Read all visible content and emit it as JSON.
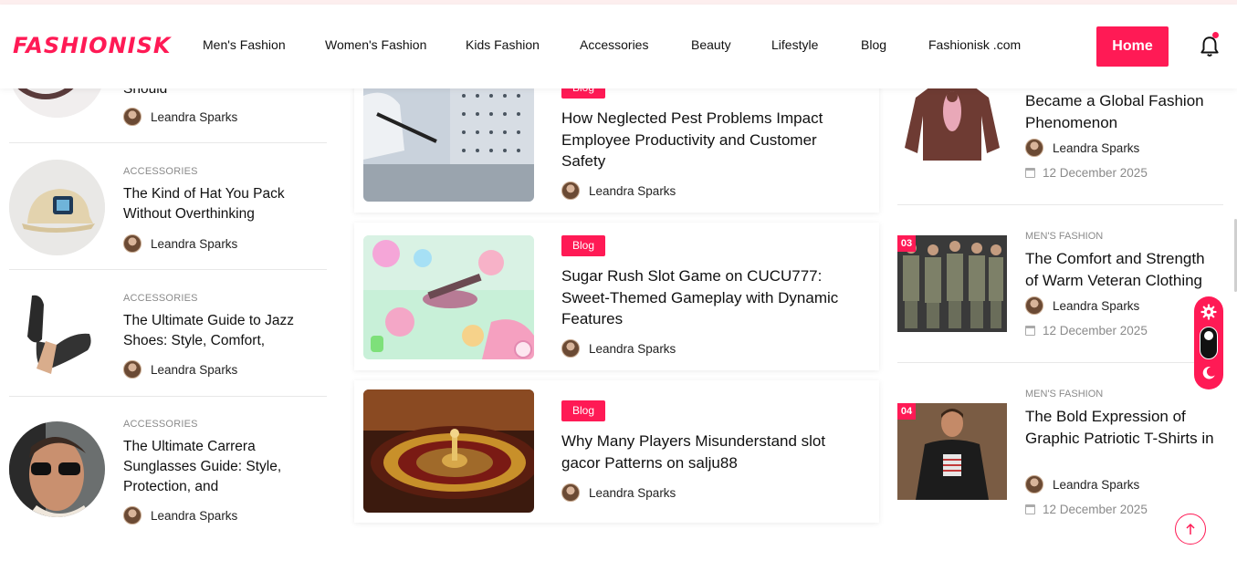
{
  "header": {
    "logo": "FASHIONISK",
    "nav": [
      "Men's Fashion",
      "Women's Fashion",
      "Kids Fashion",
      "Accessories",
      "Beauty",
      "Lifestyle",
      "Blog",
      "Fashionisk .com"
    ],
    "home_label": "Home"
  },
  "left_list": [
    {
      "category": "",
      "title": "Should",
      "author": "Leandra Sparks"
    },
    {
      "category": "ACCESSORIES",
      "title": "The Kind of Hat You Pack Without Overthinking",
      "author": "Leandra Sparks"
    },
    {
      "category": "ACCESSORIES",
      "title": "The Ultimate Guide to Jazz Shoes: Style, Comfort,",
      "author": "Leandra Sparks"
    },
    {
      "category": "ACCESSORIES",
      "title": "The Ultimate Carrera Sunglasses Guide: Style, Protection, and",
      "author": "Leandra Sparks"
    }
  ],
  "middle_list": [
    {
      "badge": "Blog",
      "title": "How Neglected Pest Problems Impact Employee Productivity and Customer Safety",
      "author": "Leandra Sparks"
    },
    {
      "badge": "Blog",
      "title": "Sugar Rush Slot Game on CUCU777: Sweet-Themed Gameplay with Dynamic Features",
      "author": "Leandra Sparks"
    },
    {
      "badge": "Blog",
      "title": "Why Many Players Misunderstand slot gacor Patterns on salju88",
      "author": "Leandra Sparks"
    }
  ],
  "right_list": [
    {
      "number": "",
      "category": "",
      "title": "Became a Global Fashion Phenomenon",
      "author": "Leandra Sparks",
      "date": "12 December 2025"
    },
    {
      "number": "03",
      "category": "MEN'S FASHION",
      "title": "The Comfort and Strength of Warm Veteran Clothing",
      "author": "Leandra Sparks",
      "date": "12 December 2025"
    },
    {
      "number": "04",
      "category": "MEN'S FASHION",
      "title": "The Bold Expression of Graphic Patriotic T-Shirts in",
      "author": "Leandra Sparks",
      "date": "12 December 2025"
    }
  ],
  "colors": {
    "accent": "#ff1a55",
    "text": "#111111",
    "muted": "#8a8a8a"
  },
  "icons": {
    "bell": "bell-icon",
    "gear": "gear-icon",
    "moon": "moon-icon",
    "up": "arrow-up-icon",
    "calendar": "calendar-icon"
  }
}
